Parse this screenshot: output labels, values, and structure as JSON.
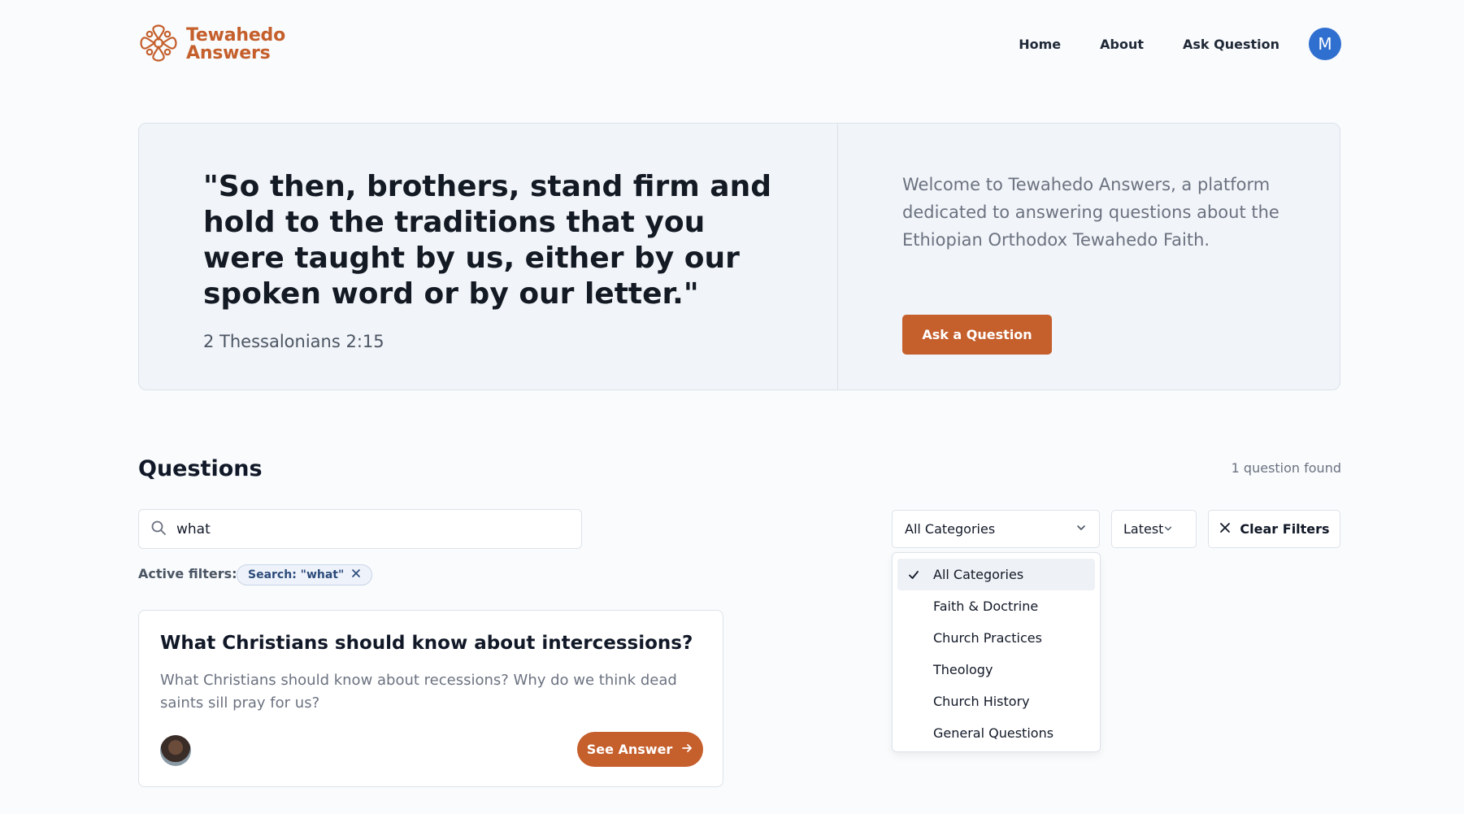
{
  "brand": {
    "line1": "Tewahedo",
    "line2": "Answers",
    "logo_icon": "ornate-cross-icon",
    "color": "#c55f2c"
  },
  "nav": {
    "items": [
      {
        "label": "Home"
      },
      {
        "label": "About"
      },
      {
        "label": "Ask Question"
      }
    ],
    "avatar_initial": "M",
    "avatar_color": "#2f6fcf"
  },
  "hero": {
    "quote": "\"So then, brothers, stand firm and hold to the traditions that you were taught by us, either by our spoken word or by our letter.\"",
    "verse": "2 Thessalonians 2:15",
    "welcome": "Welcome to Tewahedo Answers, a platform dedicated to answering questions about the Ethiopian Orthodox Tewahedo Faith.",
    "ask_button": "Ask a Question"
  },
  "questions": {
    "title": "Questions",
    "count": "1 question found",
    "search": {
      "value": "what",
      "icon": "search-icon"
    },
    "category_select": {
      "selected": "All Categories",
      "options": [
        {
          "label": "All Categories",
          "selected": true
        },
        {
          "label": "Faith & Doctrine",
          "selected": false
        },
        {
          "label": "Church Practices",
          "selected": false
        },
        {
          "label": "Theology",
          "selected": false
        },
        {
          "label": "Church History",
          "selected": false
        },
        {
          "label": "General Questions",
          "selected": false
        }
      ]
    },
    "sort_select": {
      "selected": "Latest"
    },
    "clear_filters": "Clear Filters",
    "active_filters_label": "Active filters:",
    "active_filters": [
      {
        "label": "Search: \"what\""
      }
    ],
    "cards": [
      {
        "title": "What Christians should know about intercessions?",
        "body": "What Christians should know about recessions? Why do we think dead saints sill pray for us?",
        "button": "See Answer"
      }
    ]
  }
}
